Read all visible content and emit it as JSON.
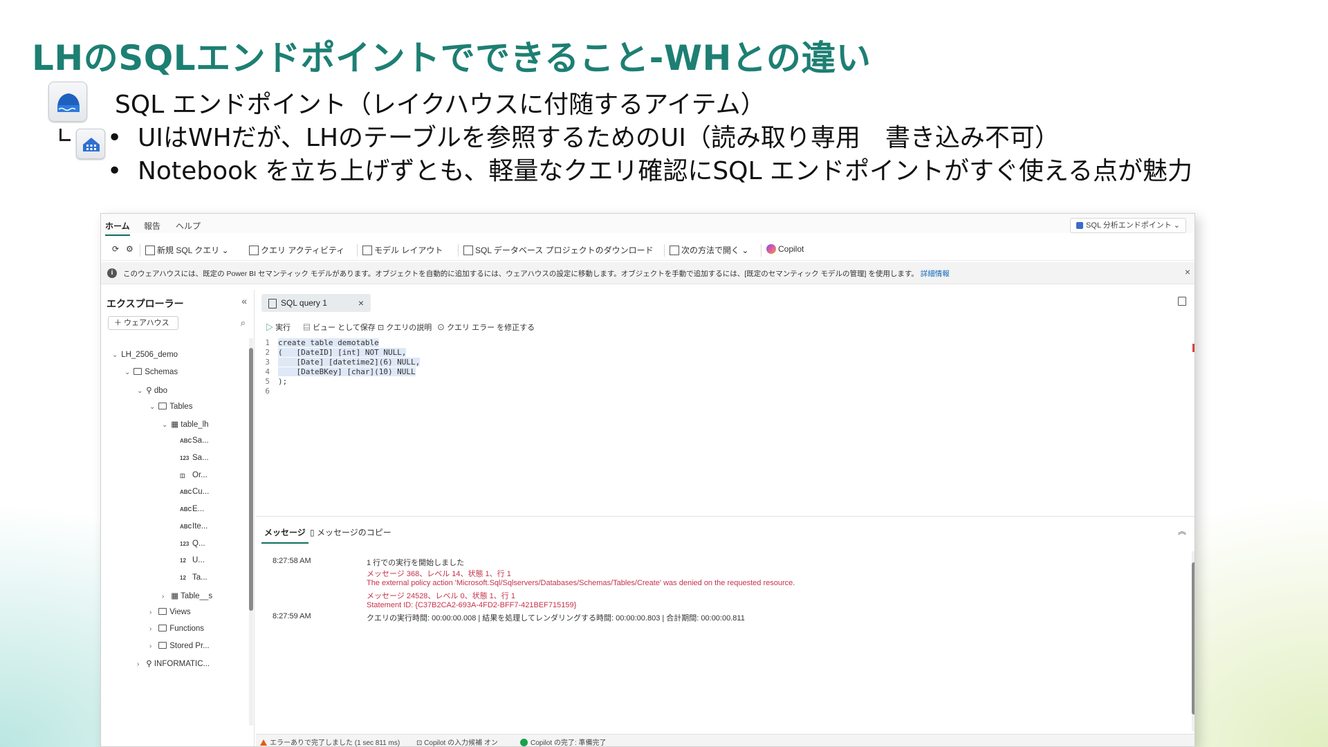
{
  "slide": {
    "title": "LHのSQLエンドポイントでできること-WHとの違い",
    "subheading": "SQL エンドポイント（レイクハウスに付随するアイテム）",
    "bullets": [
      "UIはWHだが、LHのテーブルを参照するためのUI（読み取り専用　書き込み不可）",
      "Notebook を立ち上げずとも、軽量なクエリ確認にSQL エンドポイントがすぐ使える点が魅力"
    ]
  },
  "app": {
    "ribbon_tabs": [
      "ホーム",
      "報告",
      "ヘルプ"
    ],
    "endpoint_selector": "SQL 分析エンドポイント",
    "toolbar": {
      "new_query": "新規 SQL クエリ",
      "query_activity": "クエリ アクティビティ",
      "model_layout": "モデル レイアウト",
      "download_project": "SQL データベース プロジェクトのダウンロード",
      "open_with": "次の方法で開く",
      "copilot": "Copilot"
    },
    "info_banner": {
      "message": "このウェアハウスには、既定の Power BI セマンティック モデルがあります。オブジェクトを自動的に追加するには、ウェアハウスの設定に移動します。オブジェクトを手動で追加するには、[既定のセマンティック モデルの管理] を使用します。",
      "link": "詳細情報"
    },
    "explorer": {
      "title": "エクスプローラー",
      "add_button": "＋ ウェアハウス",
      "tree": {
        "root": "LH_2506_demo",
        "schemas": "Schemas",
        "dbo": "dbo",
        "tables": "Tables",
        "table1": "table_lh",
        "columns": [
          {
            "type": "ABC",
            "name": "Sa..."
          },
          {
            "type": "123",
            "name": "Sa..."
          },
          {
            "type": "◫",
            "name": "Or..."
          },
          {
            "type": "ABC",
            "name": "Cu..."
          },
          {
            "type": "ABC",
            "name": "E..."
          },
          {
            "type": "ABC",
            "name": "Ite..."
          },
          {
            "type": "123",
            "name": "Q..."
          },
          {
            "type": "12",
            "name": "U..."
          },
          {
            "type": "12",
            "name": "Ta..."
          }
        ],
        "table2": "Table__s",
        "views": "Views",
        "functions": "Functions",
        "stored": "Stored Pr...",
        "information": "INFORMATIC..."
      }
    },
    "editor": {
      "tab_label": "SQL query 1",
      "tools": [
        "実行",
        "ビュー として保存",
        "クエリの説明",
        "クエリ エラー を修正する"
      ],
      "lines": [
        "create table demotable",
        "(   [DateID] [int] NOT NULL,",
        "    [Date] [datetime2](6) NULL,",
        "    [DateBKey] [char](10) NULL",
        ");",
        ""
      ]
    },
    "messages": {
      "tabs": [
        "メッセージ",
        "メッセージのコピー"
      ],
      "rows": [
        {
          "time": "8:27:58 AM",
          "text": "1 行での実行を開始しました",
          "err": false
        },
        {
          "time": "",
          "text": "メッセージ 368、レベル 14、状態 1、行 1",
          "err": true
        },
        {
          "time": "",
          "text": "The external policy action 'Microsoft.Sql/Sqlservers/Databases/Schemas/Tables/Create' was denied on the requested resource.",
          "err": true
        },
        {
          "time": "",
          "text": "メッセージ 24528、レベル 0、状態 1、行 1",
          "err": true
        },
        {
          "time": "",
          "text": "Statement ID: {C37B2CA2-693A-4FD2-BFF7-421BEF715159}",
          "err": true
        },
        {
          "time": "8:27:59 AM",
          "text": "クエリの実行時間: 00:00:00.008 | 結果を処理してレンダリングする時間: 00:00:00.803 | 合計期間: 00:00:00.811",
          "err": false
        }
      ]
    },
    "status": {
      "error": "エラーありで完了しました (1 sec 811 ms)",
      "copilot_input": "Copilot の入力候補 オン",
      "copilot_state": "Copilot の完了: 準備完了"
    }
  }
}
